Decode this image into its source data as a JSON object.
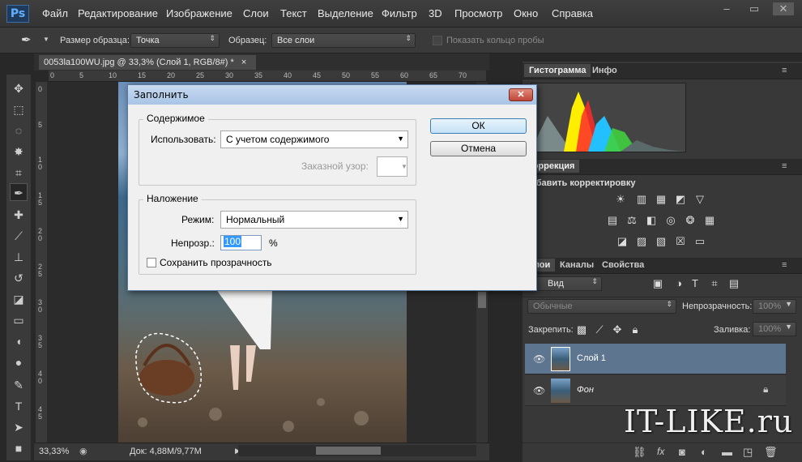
{
  "app": {
    "logo": "Ps"
  },
  "menubar": {
    "items": [
      "Файл",
      "Редактирование",
      "Изображение",
      "Слои",
      "Текст",
      "Выделение",
      "Фильтр",
      "3D",
      "Просмотр",
      "Окно",
      "Справка"
    ]
  },
  "window_buttons": {
    "min": "–",
    "max": "▭",
    "close": "✕"
  },
  "options_bar": {
    "sample_size_label": "Размер образца:",
    "sample_size_value": "Точка",
    "sample_label": "Образец:",
    "sample_value": "Все слои",
    "show_ring_label": "Показать кольцо пробы"
  },
  "document": {
    "tab_title": "0053la100WU.jpg @ 33,3% (Слой 1, RGB/8#) *",
    "tab_close": "×",
    "ruler_h": [
      "0",
      "5",
      "10",
      "15",
      "20",
      "25",
      "30",
      "35",
      "40",
      "45",
      "50",
      "55",
      "60",
      "65",
      "70"
    ],
    "ruler_v": [
      "0",
      "5",
      "1\n0",
      "1\n5",
      "2\n0",
      "2\n5",
      "3\n0",
      "3\n5",
      "4\n0",
      "4\n5"
    ],
    "status_zoom": "33,33%",
    "status_doc": "Док: 4,88M/9,77M"
  },
  "panels": {
    "top_tabs": [
      "Гистограмма",
      "Инфо"
    ],
    "correction_tab": "Коррекция",
    "add_correction": "Добавить корректировку",
    "layers_tabs": [
      "Слои",
      "Каналы",
      "Свойства"
    ],
    "kind_filter": "Вид",
    "blend_mode": "Обычные",
    "opacity_label": "Непрозрачность:",
    "opacity_value": "100%",
    "lock_label": "Закрепить:",
    "fill_label": "Заливка:",
    "fill_value": "100%",
    "layers": [
      {
        "name": "Слой 1",
        "selected": true
      },
      {
        "name": "Фон",
        "locked": true
      }
    ]
  },
  "dialog": {
    "title": "Заполнить",
    "close": "✕",
    "contents_group": "Содержимое",
    "use_label": "Использовать:",
    "use_value": "С учетом содержимого",
    "custom_pattern_label": "Заказной узор:",
    "blending_group": "Наложение",
    "mode_label": "Режим:",
    "mode_value": "Нормальный",
    "opacity_label": "Непрозр.:",
    "opacity_value": "100",
    "opacity_unit": "%",
    "preserve_label": "Сохранить прозрачность",
    "ok": "ОК",
    "cancel": "Отмена"
  },
  "watermark": "IT-LIKE.ru",
  "colors": {
    "accent": "#3c7fb1",
    "panel_bg": "#383838",
    "dialog_bg": "#f0f0f0"
  }
}
